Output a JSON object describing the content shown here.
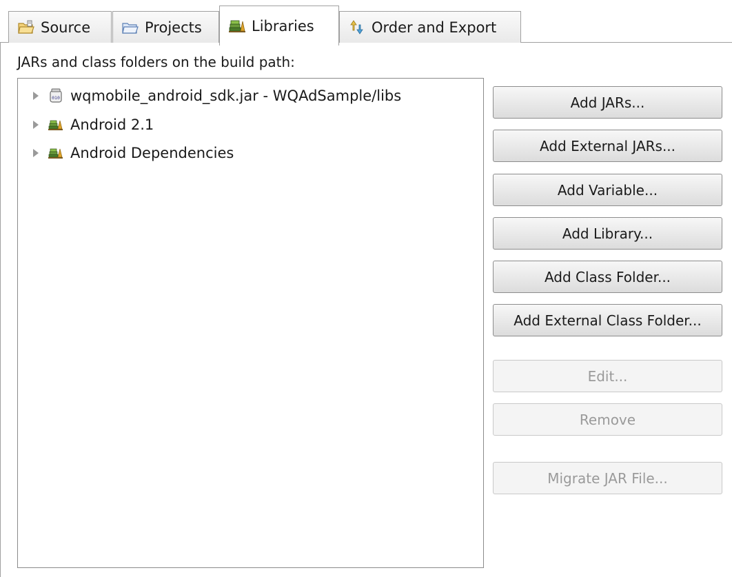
{
  "tabs": [
    {
      "label": "Source",
      "icon": "source-folder-icon"
    },
    {
      "label": "Projects",
      "icon": "projects-folder-icon"
    },
    {
      "label": "Libraries",
      "icon": "libraries-icon"
    },
    {
      "label": "Order and Export",
      "icon": "order-export-icon"
    }
  ],
  "active_tab": "Libraries",
  "heading": "JARs and class folders on the build path:",
  "tree": {
    "items": [
      {
        "label": "wqmobile_android_sdk.jar - WQAdSample/libs",
        "icon": "jar-file-icon",
        "expanded": false
      },
      {
        "label": "Android 2.1",
        "icon": "library-container-icon",
        "expanded": false
      },
      {
        "label": "Android Dependencies",
        "icon": "library-container-icon",
        "expanded": false
      }
    ]
  },
  "buttons": {
    "add_jars": "Add JARs...",
    "add_external_jars": "Add External JARs...",
    "add_variable": "Add Variable...",
    "add_library": "Add Library...",
    "add_class_folder": "Add Class Folder...",
    "add_external_class_folder": "Add External Class Folder...",
    "edit": "Edit...",
    "remove": "Remove",
    "migrate_jar": "Migrate JAR File..."
  },
  "colors": {
    "tab_border": "#a0a0a0",
    "disabled_text": "#9a9a9a",
    "library_books": "#6a9a3a"
  }
}
